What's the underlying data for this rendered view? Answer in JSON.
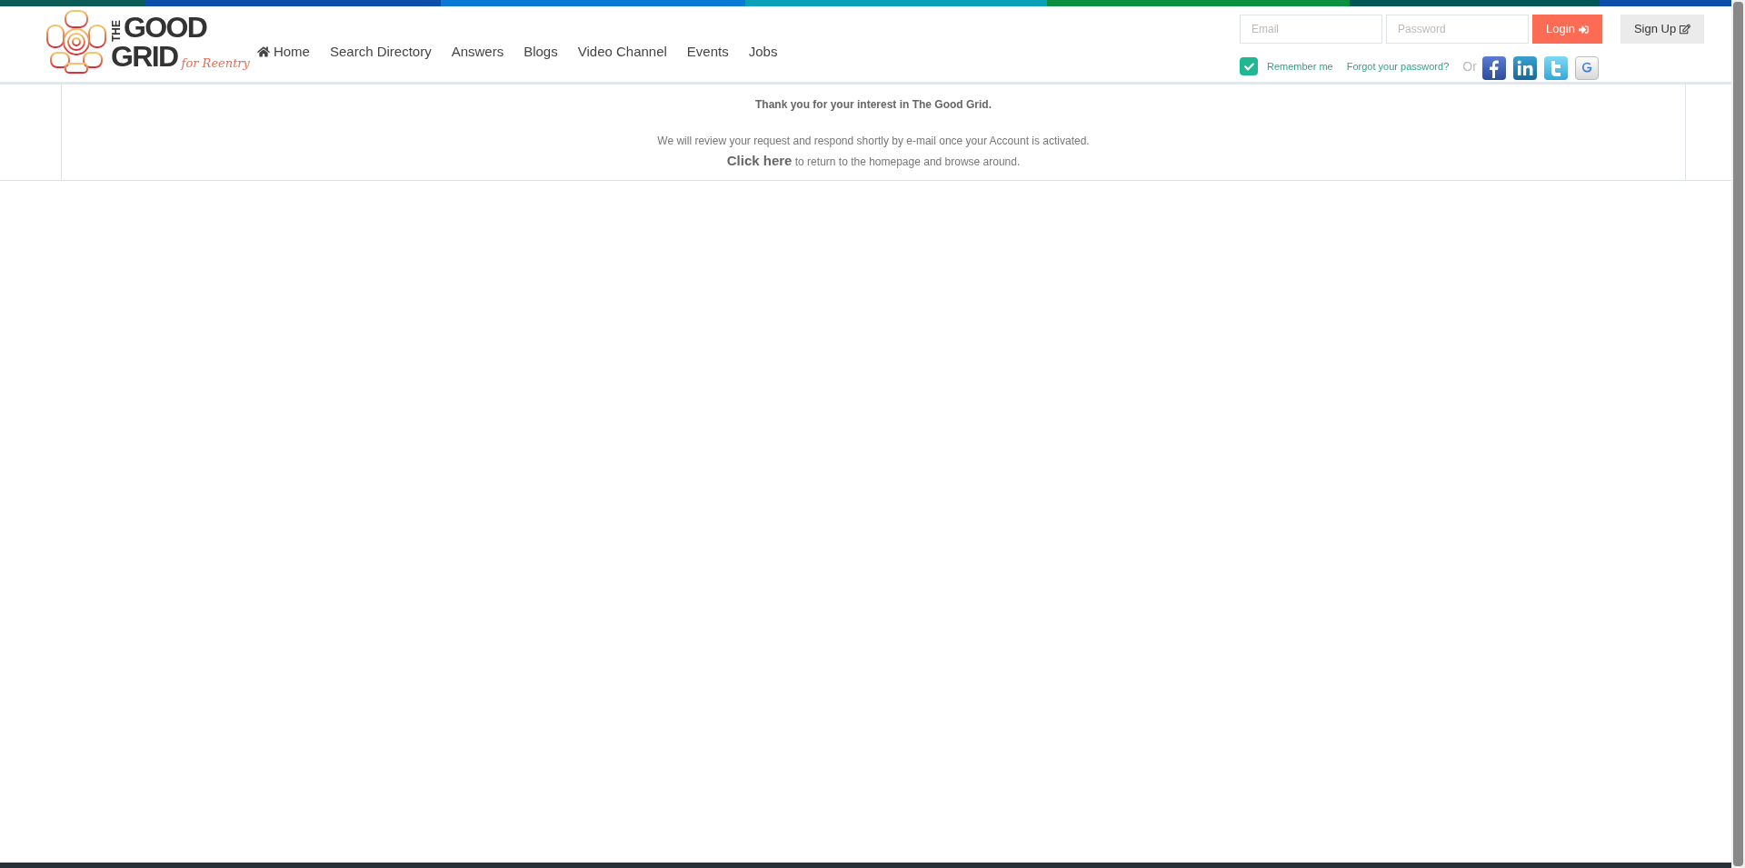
{
  "logo": {
    "line_1a": "THE",
    "line_1b": "GOOD",
    "line_2": "GRID",
    "tagline": "for Reentry"
  },
  "nav": [
    {
      "label": "Home"
    },
    {
      "label": "Search Directory"
    },
    {
      "label": "Answers"
    },
    {
      "label": "Blogs"
    },
    {
      "label": "Video Channel"
    },
    {
      "label": "Events"
    },
    {
      "label": "Jobs"
    }
  ],
  "login": {
    "email_placeholder": "Email",
    "password_placeholder": "Password",
    "login_button": "Login",
    "signup_button": "Sign Up",
    "remember": {
      "label": "Remember me",
      "checked": true
    },
    "forgot_link": "Forgot your password?",
    "or_label": "Or"
  },
  "social": [
    {
      "kind": "facebook"
    },
    {
      "kind": "linkedin"
    },
    {
      "kind": "twitter"
    },
    {
      "kind": "google"
    }
  ],
  "message": {
    "heading": "Thank you for your interest in The Good Grid.",
    "body": "We will review your request and respond shortly by e-mail once your Account is activated.",
    "link": "Click here",
    "link_suffix": "to return to the homepage and browse around."
  }
}
